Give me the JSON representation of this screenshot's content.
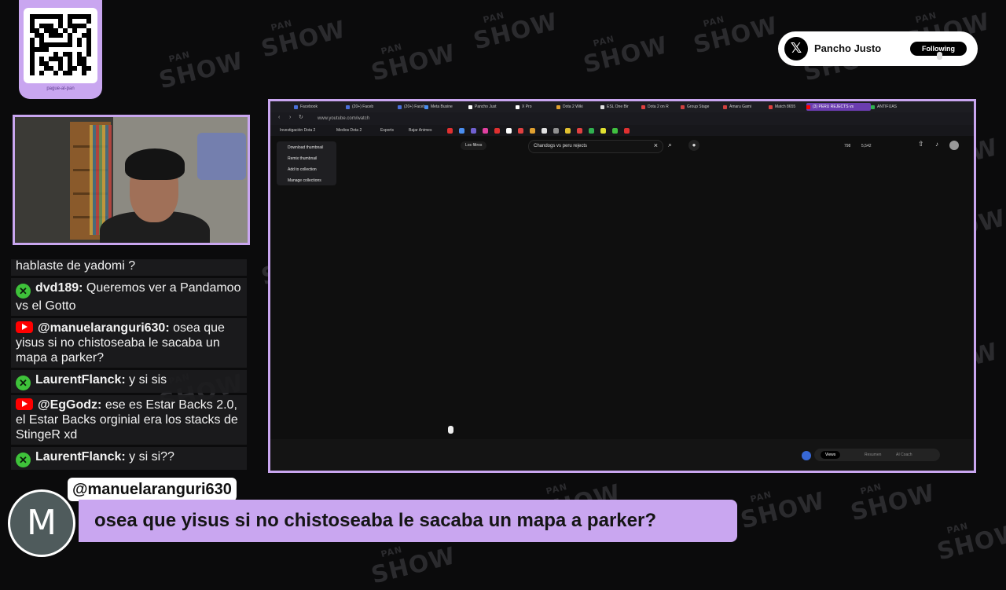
{
  "qr": {
    "caption": "pague-al-pan"
  },
  "follow_card": {
    "name": "Pancho Justo",
    "button": "Following"
  },
  "chat": [
    {
      "platform": "youtube",
      "user": "",
      "text": "hablaste de yadomi ?"
    },
    {
      "platform": "kick",
      "user": "dvd189:",
      "text": "Queremos ver a Pandamoo vs el Gotto"
    },
    {
      "platform": "youtube",
      "user": "@manuelaranguri630:",
      "text": "osea que yisus si no chistoseaba le sacaba un mapa a parker?"
    },
    {
      "platform": "kick",
      "user": "LaurentFlanck:",
      "text": "y si sis"
    },
    {
      "platform": "youtube",
      "user": "@EgGodz:",
      "text": "ese es Estar Backs 2.0, el Estar Backs orginial era los stacks de StingeR xd"
    },
    {
      "platform": "kick",
      "user": "LaurentFlanck:",
      "text": "y si si??"
    }
  ],
  "browser": {
    "tabs": [
      {
        "label": "Facebook",
        "color": "#4a6fd8"
      },
      {
        "label": "(20+) Faceb",
        "color": "#4a6fd8"
      },
      {
        "label": "(20+) Faceb",
        "color": "#4a6fd8"
      },
      {
        "label": "Meta Busine",
        "color": "#4a8ef0"
      },
      {
        "label": "Pancho Just",
        "color": "#ffffff"
      },
      {
        "label": "X Pro",
        "color": "#ffffff"
      },
      {
        "label": "Dota 2 Wiki",
        "color": "#e0a030"
      },
      {
        "label": "ESL One Bir",
        "color": "#e0e0e0"
      },
      {
        "label": "Dota 2 on R",
        "color": "#e04040"
      },
      {
        "label": "Group Stage",
        "color": "#d04040"
      },
      {
        "label": "Amaru Gami",
        "color": "#d04040"
      },
      {
        "label": "Match 8655",
        "color": "#e04040"
      },
      {
        "label": "(3) PERU REJECTS vs",
        "color": "#ff0000",
        "active": true
      },
      {
        "label": "ANTIFIJAS",
        "color": "#30b050"
      }
    ],
    "url": "www.youtube.com/watch",
    "bookmarks": [
      "Investigación Dota 2",
      "Medios Dota 2",
      "Esports",
      "Bajar Animes"
    ],
    "filters_label": "Los filtros",
    "search_value": "Chandogs vs peru rejects",
    "stats": {
      "views": "798",
      "likes": "5,542"
    },
    "context_menu": [
      "Download thumbnail",
      "Remix thumbnail",
      "Add to collection",
      "Manage collections"
    ],
    "bottom_tabs": [
      "Views",
      "Resumen",
      "AI Coach"
    ]
  },
  "banner": {
    "avatar_letter": "M",
    "username": "@manuelaranguri630",
    "message": "osea que yisus si no chistoseaba le sacaba un mapa a parker?"
  },
  "watermark": {
    "big": "SHOW",
    "small": "PAN"
  }
}
